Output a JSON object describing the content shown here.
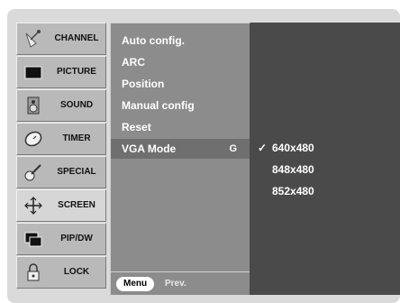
{
  "sidebar": {
    "items": [
      {
        "label": "CHANNEL",
        "icon": "satellite-dish-icon"
      },
      {
        "label": "PICTURE",
        "icon": "tv-screen-icon"
      },
      {
        "label": "SOUND",
        "icon": "speaker-icon"
      },
      {
        "label": "TIMER",
        "icon": "clock-icon"
      },
      {
        "label": "SPECIAL",
        "icon": "guitar-icon"
      },
      {
        "label": "SCREEN",
        "icon": "screen-adjust-icon",
        "selected": true
      },
      {
        "label": "PIP/DW",
        "icon": "pip-windows-icon"
      },
      {
        "label": "LOCK",
        "icon": "padlock-icon"
      }
    ]
  },
  "submenu": {
    "items": [
      {
        "label": "Auto config."
      },
      {
        "label": "ARC"
      },
      {
        "label": "Position"
      },
      {
        "label": "Manual config"
      },
      {
        "label": "Reset"
      },
      {
        "label": "VGA Mode",
        "shortcut": "G",
        "highlighted": true
      }
    ],
    "footer": {
      "menu_button": "Menu",
      "prev_label": "Prev."
    }
  },
  "vga_options": [
    {
      "label": "640x480",
      "checked": true
    },
    {
      "label": "848x480",
      "checked": false
    },
    {
      "label": "852x480",
      "checked": false
    }
  ],
  "check_mark": "✓",
  "colors": {
    "background": "#dadada",
    "sidebar": "#b9b9b9",
    "panel": "#8c8c8c",
    "options": "#4a4a4a",
    "highlight": "#6f6f6f"
  }
}
